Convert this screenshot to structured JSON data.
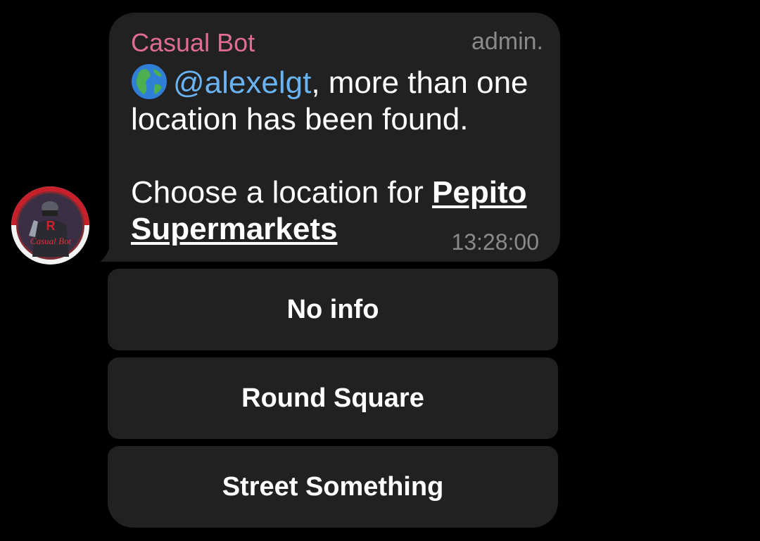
{
  "message": {
    "sender": "Casual Bot",
    "role": "admin.",
    "mention": "@alexelgt",
    "text_after_mention": ", more than one location has been found.",
    "choose_text": "Choose a location for ",
    "place_name": "Pepito Supermarkets",
    "time": "13:28:00",
    "icon": "globe-icon"
  },
  "avatar": {
    "text": "Casual Bot",
    "letter": "R"
  },
  "keyboard": {
    "buttons": [
      {
        "label": "No info"
      },
      {
        "label": "Round Square"
      },
      {
        "label": "Street Something"
      }
    ]
  },
  "colors": {
    "background": "#000000",
    "bubble": "#212121",
    "sender": "#e06c96",
    "mention": "#6ab3f3",
    "meta": "#8a8a8a"
  }
}
